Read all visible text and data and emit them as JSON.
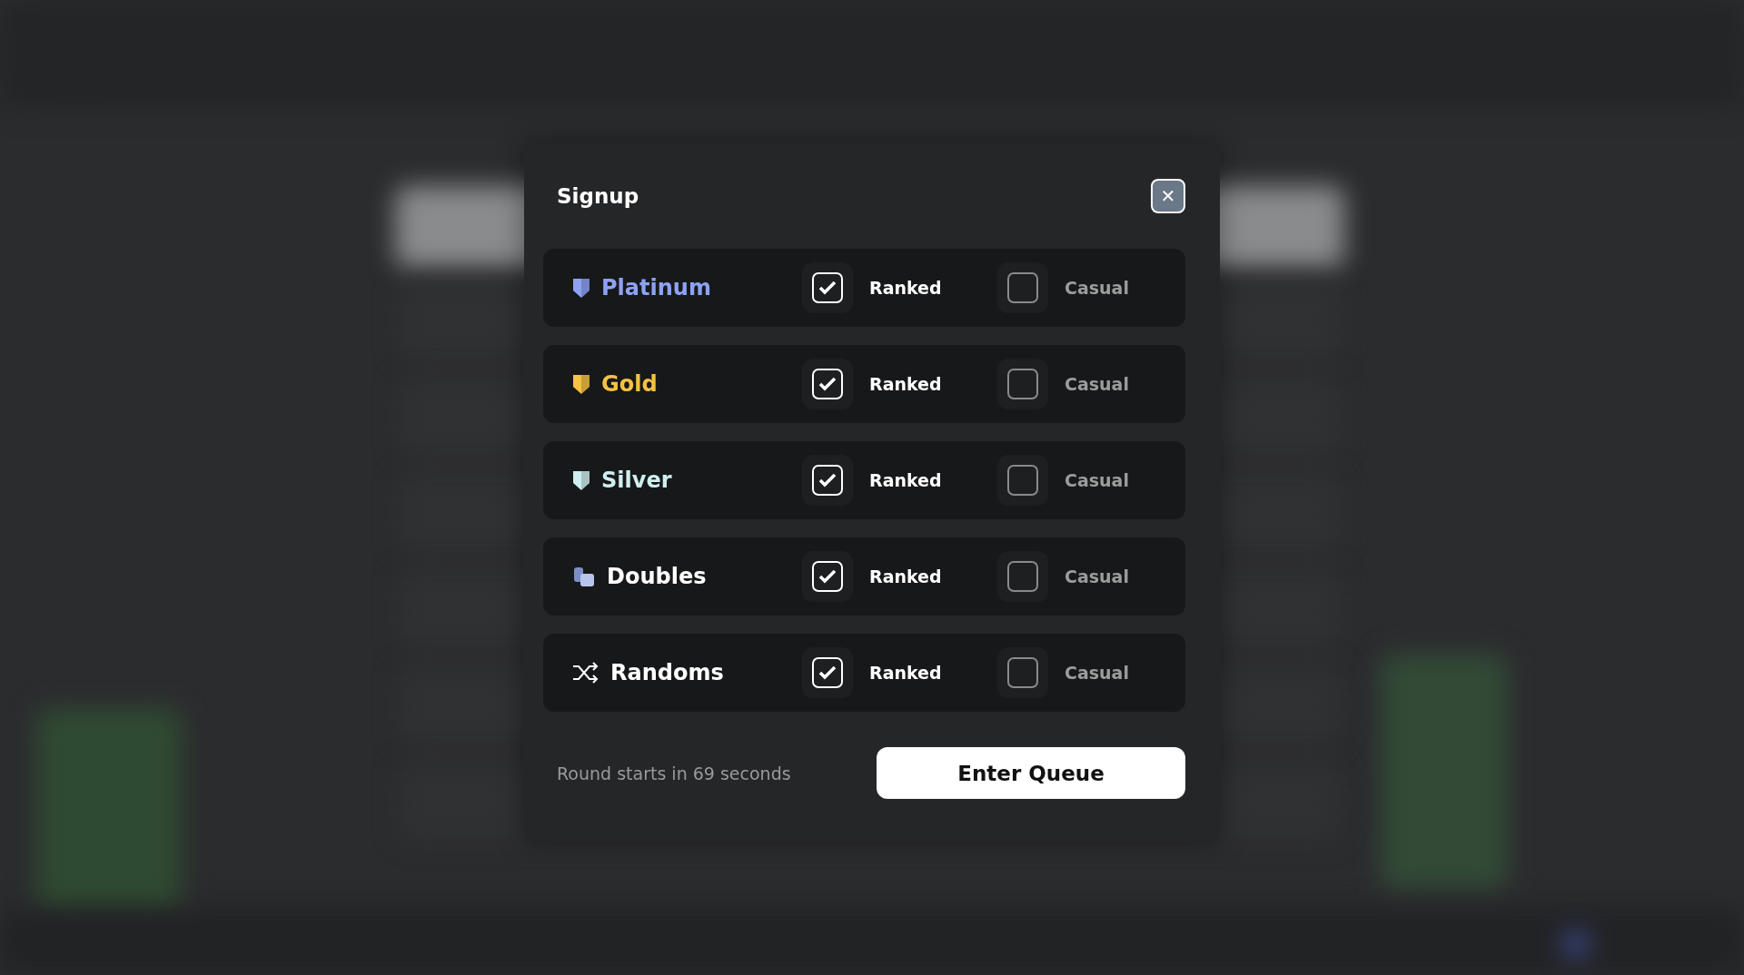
{
  "dialog": {
    "title": "Signup",
    "close_label": "✕"
  },
  "queues": [
    {
      "label": "Platinum",
      "kind": "shield",
      "color": "#8ea2f5",
      "ranked": {
        "label": "Ranked",
        "checked": true
      },
      "casual": {
        "label": "Casual",
        "checked": false
      }
    },
    {
      "label": "Gold",
      "kind": "shield",
      "color": "#f5c242",
      "ranked": {
        "label": "Ranked",
        "checked": true
      },
      "casual": {
        "label": "Casual",
        "checked": false
      }
    },
    {
      "label": "Silver",
      "kind": "shield",
      "color": "#cfeef0",
      "ranked": {
        "label": "Ranked",
        "checked": true
      },
      "casual": {
        "label": "Casual",
        "checked": false
      }
    },
    {
      "label": "Doubles",
      "kind": "doubles",
      "color": "#ffffff",
      "ranked": {
        "label": "Ranked",
        "checked": true
      },
      "casual": {
        "label": "Casual",
        "checked": false
      }
    },
    {
      "label": "Randoms",
      "kind": "shuffle",
      "color": "#ffffff",
      "ranked": {
        "label": "Ranked",
        "checked": true
      },
      "casual": {
        "label": "Casual",
        "checked": false
      }
    }
  ],
  "footer": {
    "countdown": "Round starts in 69 seconds",
    "button": "Enter Queue"
  }
}
